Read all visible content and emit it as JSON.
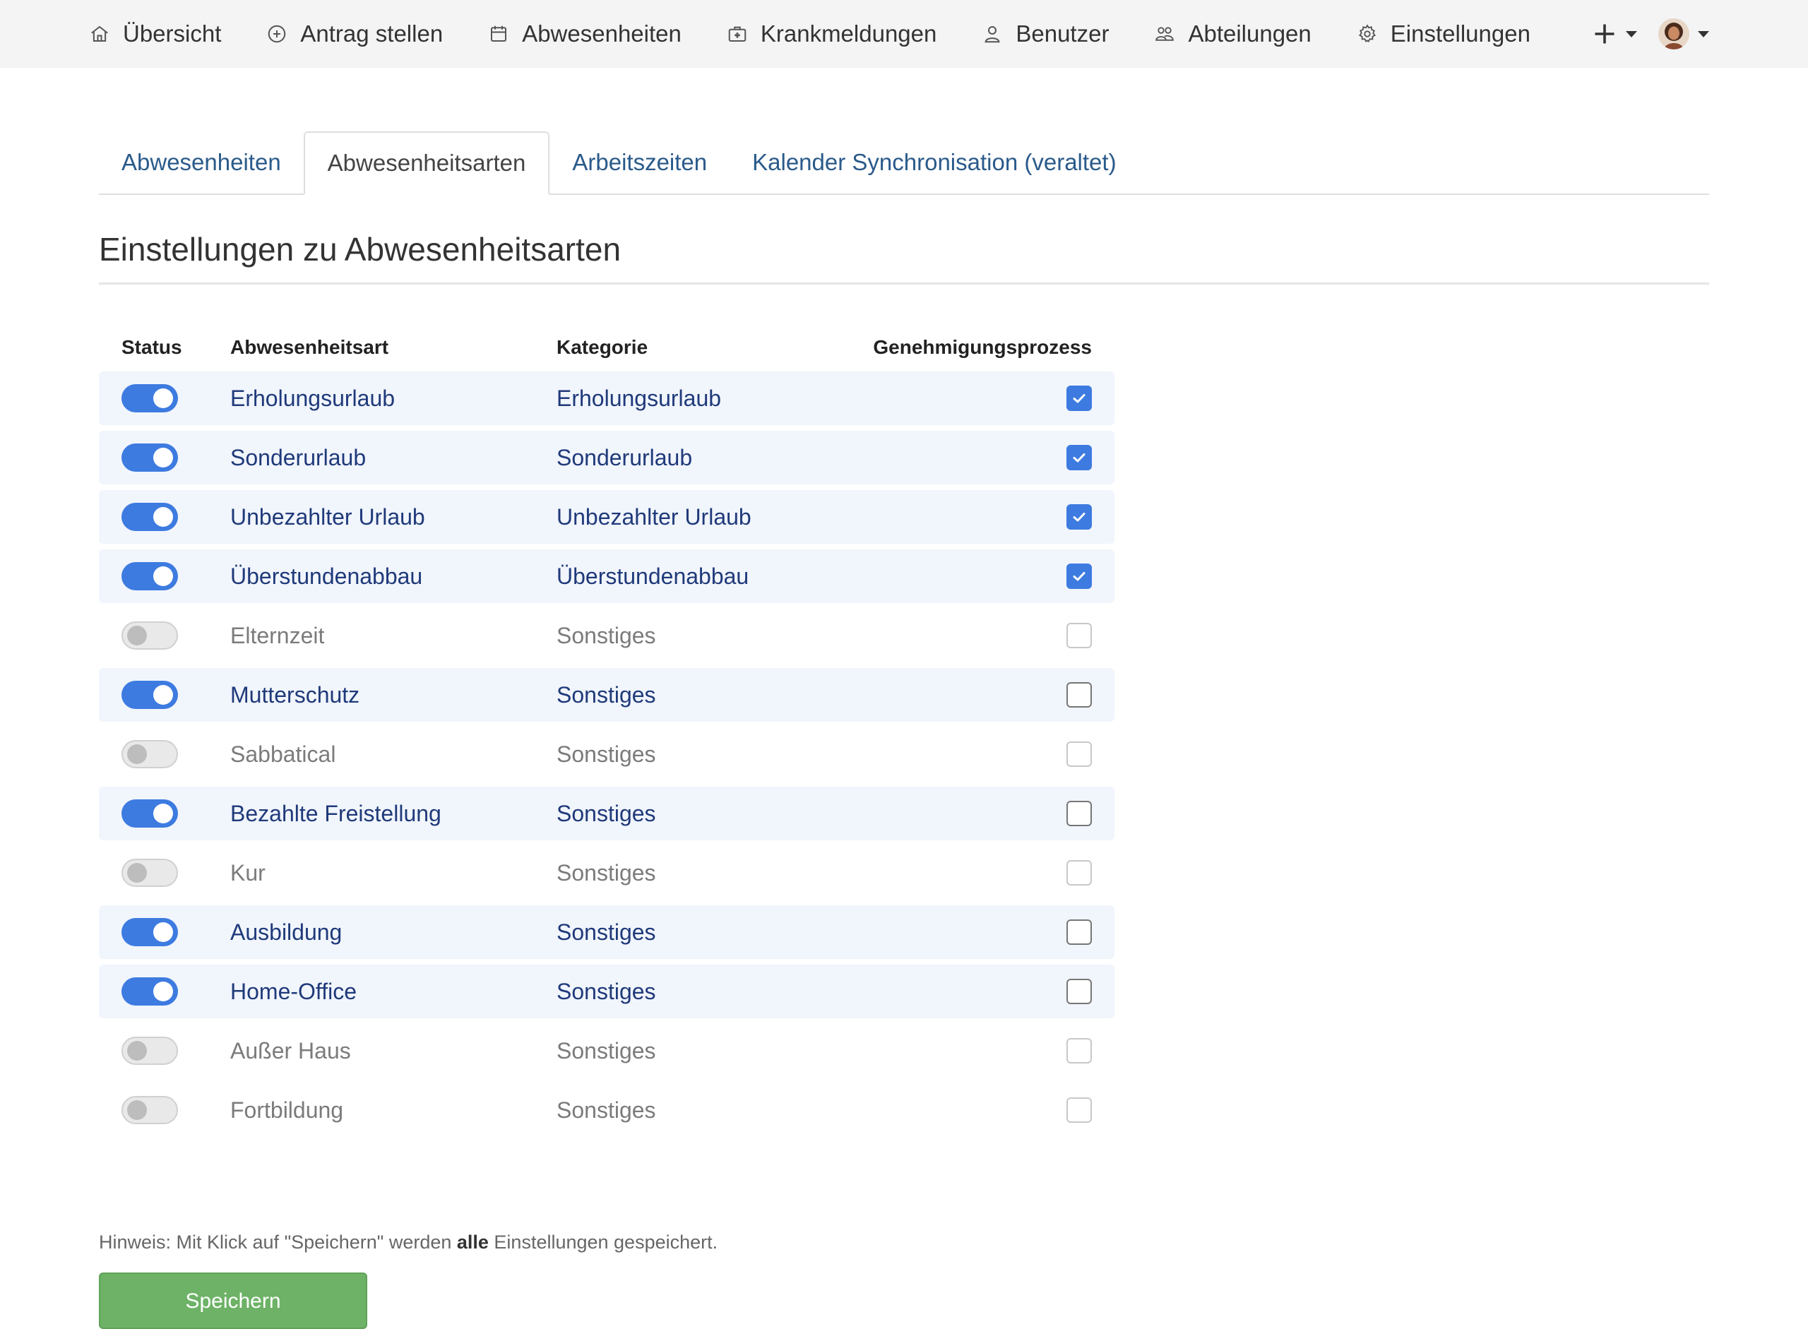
{
  "nav": {
    "items": [
      {
        "label": "Übersicht",
        "icon": "home-icon"
      },
      {
        "label": "Antrag stellen",
        "icon": "plus-circle-icon"
      },
      {
        "label": "Abwesenheiten",
        "icon": "calendar-icon"
      },
      {
        "label": "Krankmeldungen",
        "icon": "medical-case-icon"
      },
      {
        "label": "Benutzer",
        "icon": "user-icon"
      },
      {
        "label": "Abteilungen",
        "icon": "users-group-icon"
      },
      {
        "label": "Einstellungen",
        "icon": "gear-icon"
      }
    ]
  },
  "tabs": [
    {
      "label": "Abwesenheiten",
      "active": false
    },
    {
      "label": "Abwesenheitsarten",
      "active": true
    },
    {
      "label": "Arbeitszeiten",
      "active": false
    },
    {
      "label": "Kalender Synchronisation (veraltet)",
      "active": false
    }
  ],
  "page_title": "Einstellungen zu Abwesenheitsarten",
  "table": {
    "headers": {
      "status": "Status",
      "type": "Abwesenheitsart",
      "category": "Kategorie",
      "approval": "Genehmigungsprozess"
    },
    "rows": [
      {
        "type": "Erholungsurlaub",
        "category": "Erholungsurlaub",
        "enabled": true,
        "approval": true
      },
      {
        "type": "Sonderurlaub",
        "category": "Sonderurlaub",
        "enabled": true,
        "approval": true
      },
      {
        "type": "Unbezahlter Urlaub",
        "category": "Unbezahlter Urlaub",
        "enabled": true,
        "approval": true
      },
      {
        "type": "Überstundenabbau",
        "category": "Überstundenabbau",
        "enabled": true,
        "approval": true
      },
      {
        "type": "Elternzeit",
        "category": "Sonstiges",
        "enabled": false,
        "approval": false
      },
      {
        "type": "Mutterschutz",
        "category": "Sonstiges",
        "enabled": true,
        "approval": false
      },
      {
        "type": "Sabbatical",
        "category": "Sonstiges",
        "enabled": false,
        "approval": false
      },
      {
        "type": "Bezahlte Freistellung",
        "category": "Sonstiges",
        "enabled": true,
        "approval": false
      },
      {
        "type": "Kur",
        "category": "Sonstiges",
        "enabled": false,
        "approval": false
      },
      {
        "type": "Ausbildung",
        "category": "Sonstiges",
        "enabled": true,
        "approval": false
      },
      {
        "type": "Home-Office",
        "category": "Sonstiges",
        "enabled": true,
        "approval": false
      },
      {
        "type": "Außer Haus",
        "category": "Sonstiges",
        "enabled": false,
        "approval": false
      },
      {
        "type": "Fortbildung",
        "category": "Sonstiges",
        "enabled": false,
        "approval": false
      }
    ]
  },
  "hint": {
    "prefix": "Hinweis: Mit Klick auf \"Speichern\" werden ",
    "bold": "alle",
    "suffix": " Einstellungen gespeichert."
  },
  "save_label": "Speichern",
  "colors": {
    "accent": "#3d7be0",
    "active_row_bg": "#f1f5fc",
    "save_button": "#6db266"
  }
}
